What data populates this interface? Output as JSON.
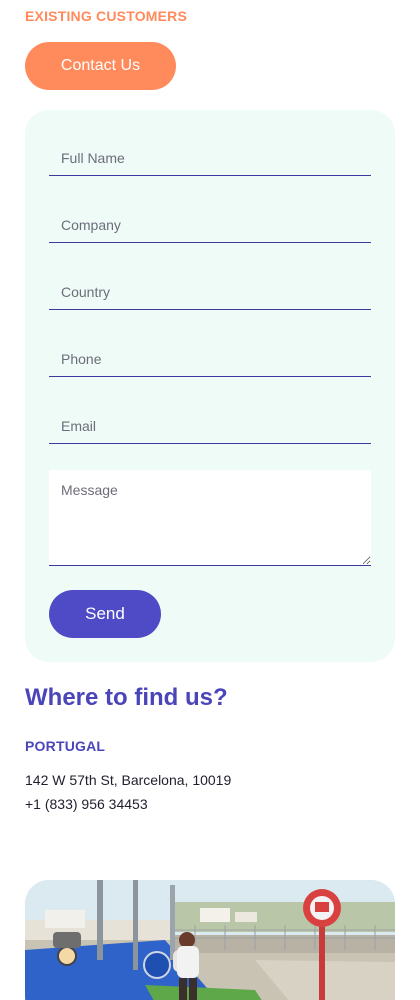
{
  "header": {
    "eyebrow": "EXISTING CUSTOMERS",
    "contact_label": "Contact Us"
  },
  "form": {
    "full_name_placeholder": "Full Name",
    "company_placeholder": "Company",
    "country_placeholder": "Country",
    "phone_placeholder": "Phone",
    "email_placeholder": "Email",
    "message_placeholder": "Message",
    "send_label": "Send"
  },
  "location": {
    "title": "Where to find us?",
    "country": "PORTUGAL",
    "address": "142 W 57th St, Barcelona, 10019",
    "phone": "+1 (833) 956 34453"
  },
  "colors": {
    "accent_orange": "#ff8a5b",
    "primary_indigo": "#4f4bc6",
    "form_background": "#eefbf6"
  }
}
